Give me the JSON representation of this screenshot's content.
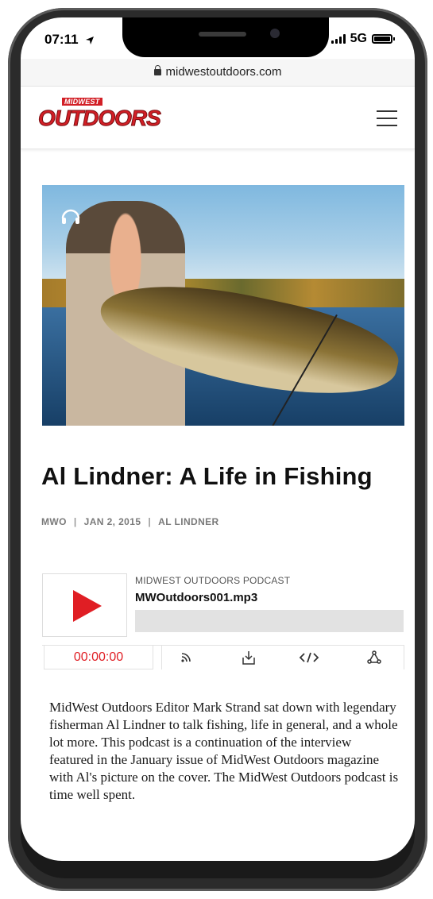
{
  "status": {
    "time": "07:11",
    "network": "5G"
  },
  "browser": {
    "url": "midwestoutdoors.com"
  },
  "site": {
    "logo_small": "MIDWEST",
    "logo_big": "OUTDOORS"
  },
  "article": {
    "title": "Al Lindner: A Life in Fishing",
    "meta": {
      "author": "MWO",
      "date": "JAN 2, 2015",
      "tag": "AL LINDNER"
    },
    "description": "MidWest Outdoors Editor Mark Strand sat down with legendary fisherman Al Lindner to talk fishing, life in general, and a whole lot more. This podcast is a continuation of the interview featured in the January issue of MidWest Outdoors magazine with Al's picture on the cover. The MidWest Outdoors podcast is time well spent."
  },
  "player": {
    "podcast_name": "MIDWEST OUTDOORS PODCAST",
    "file_name": "MWOutdoors001.mp3",
    "time": "00:00:00",
    "progress": 0
  },
  "colors": {
    "brand_red": "#d21f26",
    "play_red": "#e01e24"
  }
}
